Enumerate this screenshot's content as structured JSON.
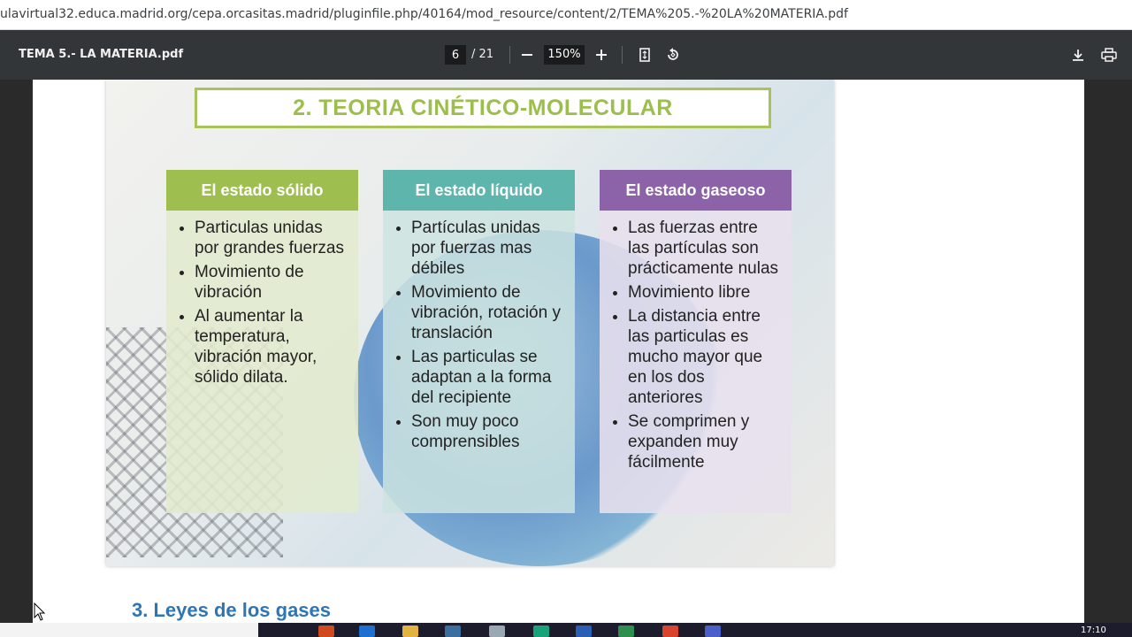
{
  "browser": {
    "url": "ulavirtual32.educa.madrid.org/cepa.orcasitas.madrid/pluginfile.php/40164/mod_resource/content/2/TEMA%205.-%20LA%20MATERIA.pdf"
  },
  "pdf_toolbar": {
    "title": "TEMA 5.- LA MATERIA.pdf",
    "current_page": "6",
    "total_pages": "/ 21",
    "zoom": "150%"
  },
  "slide": {
    "title": "2. TEORIA CINÉTICO-MOLECULAR",
    "columns": [
      {
        "heading": "El estado sólido",
        "items": [
          "Particulas unidas por grandes fuerzas",
          "Movimiento de vibración",
          "Al aumentar la temperatura, vibración mayor, sólido dilata."
        ]
      },
      {
        "heading": "El estado líquido",
        "items": [
          "Partículas unidas por fuerzas mas débiles",
          "Movimiento de vibración, rotación y translación",
          "Las particulas se adaptan a la forma del recipiente",
          "Son muy poco comprensibles"
        ]
      },
      {
        "heading": "El estado gaseoso",
        "items": [
          "Las fuerzas entre las partículas son prácticamente nulas",
          "Movimiento libre",
          "La distancia entre las particulas es mucho mayor que en los dos anteriores",
          "Se comprimen y expanden muy fácilmente"
        ]
      }
    ]
  },
  "document": {
    "next_heading": "3.  Leyes de los gases"
  },
  "taskbar": {
    "clock": "17:10"
  },
  "colors": {
    "solid_header": "#9fbe50",
    "liquid_header": "#5db5ab",
    "gas_header": "#8c63a8",
    "title_green": "#9cbe4c",
    "heading_blue": "#2e75b6"
  }
}
